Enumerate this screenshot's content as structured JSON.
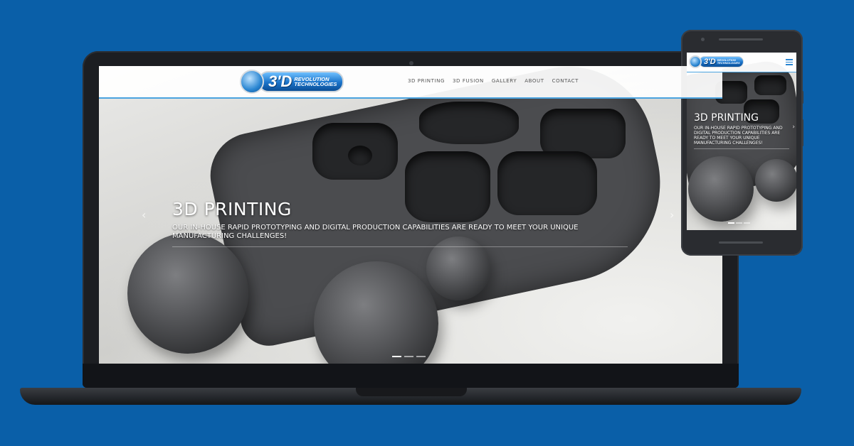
{
  "site": {
    "logo_mark": "3'D",
    "logo_line1": "Revolution",
    "logo_line2": "Technologies"
  },
  "nav": {
    "items": [
      "3D PRINTING",
      "3D FUSION",
      "GALLERY",
      "ABOUT",
      "CONTACT"
    ]
  },
  "hero": {
    "title": "3D PRINTING",
    "subtitle": "OUR IN-HOUSE RAPID PROTOTYPING AND DIGITAL PRODUCTION CAPABILITIES ARE READY TO MEET YOUR UNIQUE MANUFACTURING CHALLENGES!",
    "prev_icon": "‹",
    "next_icon": "›",
    "slides": 3,
    "active_slide": 1
  },
  "colors": {
    "background": "#0a5fa8",
    "accent": "#2a86d2",
    "nav_border": "#4aa3df"
  },
  "icons": [
    "chevron-left-icon",
    "chevron-right-icon",
    "hamburger-menu-icon",
    "globe-logo-icon"
  ]
}
